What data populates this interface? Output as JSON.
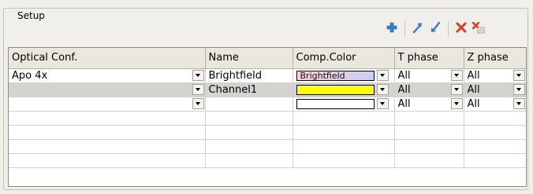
{
  "group": {
    "title": "Setup"
  },
  "toolbar": {
    "buttons": [
      {
        "icon": "plus-icon",
        "color": "#2f7fd8"
      },
      {
        "icon": "move-up-icon",
        "color": "#2f7fd8"
      },
      {
        "icon": "move-down-icon",
        "color": "#2f7fd8"
      },
      {
        "icon": "delete-icon",
        "color": "#e03a1e"
      },
      {
        "icon": "delete-all-icon",
        "color": "#e03a1e"
      }
    ]
  },
  "table": {
    "columns": [
      "Optical Conf.",
      "Name",
      "Comp.Color",
      "T phase",
      "Z phase"
    ],
    "rows": [
      {
        "optical": "Apo 4x",
        "name": "Brightfield",
        "color_label": "Brightfield",
        "color_from": "#ffd0d0",
        "color_to": "#c9cff8",
        "t_phase": "All",
        "z_phase": "All"
      },
      {
        "optical": "",
        "name": "Channel1",
        "color_label": "",
        "color_from": "#ffff00",
        "color_to": "#ffff00",
        "t_phase": "All",
        "z_phase": "All"
      },
      {
        "optical": "",
        "name": "",
        "color_label": "",
        "color_from": "#ffffff",
        "color_to": "#ffffff",
        "t_phase": "All",
        "z_phase": "All"
      }
    ]
  }
}
